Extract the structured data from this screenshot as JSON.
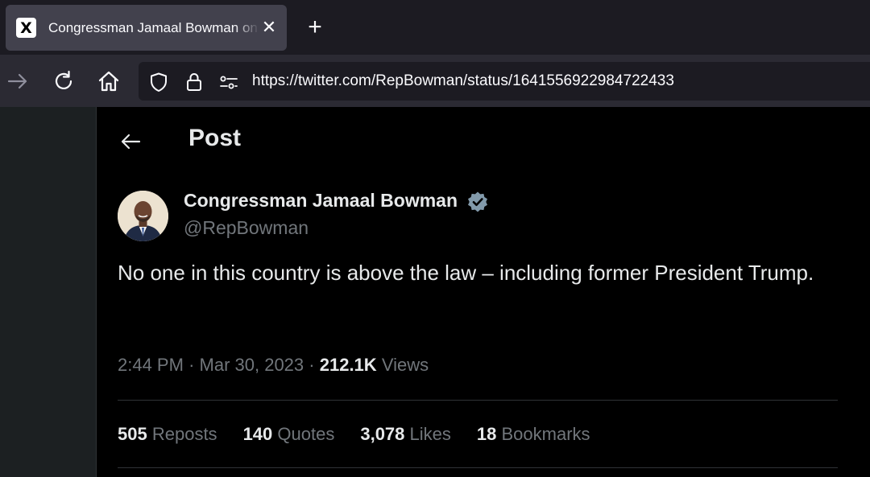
{
  "browser": {
    "tab": {
      "favicon": "X",
      "title": "Congressman Jamaal Bowman on X",
      "close_glyph": "✕"
    },
    "new_tab_glyph": "+",
    "nav_icons": [
      "forward-arrow-icon",
      "reload-icon",
      "home-icon"
    ],
    "url_icons": [
      "shield-icon",
      "lock-icon",
      "permissions-icon"
    ],
    "url": "https://twitter.com/RepBowman/status/1641556922984722433"
  },
  "post": {
    "heading": "Post",
    "author": {
      "name": "Congressman Jamaal Bowman",
      "handle": "@RepBowman",
      "verified": true
    },
    "text": "No one in this country is above the law – including former President Trump.",
    "time": "2:44 PM",
    "date": "Mar 30, 2023",
    "views_count": "212.1K",
    "views_label": "Views",
    "stats": [
      {
        "count": "505",
        "label": "Reposts"
      },
      {
        "count": "140",
        "label": "Quotes"
      },
      {
        "count": "3,078",
        "label": "Likes"
      },
      {
        "count": "18",
        "label": "Bookmarks"
      }
    ]
  },
  "colors": {
    "text_primary": "#e7e9ea",
    "text_secondary": "#71767b",
    "verified_badge": "#829aab",
    "divider": "#2f3336"
  }
}
